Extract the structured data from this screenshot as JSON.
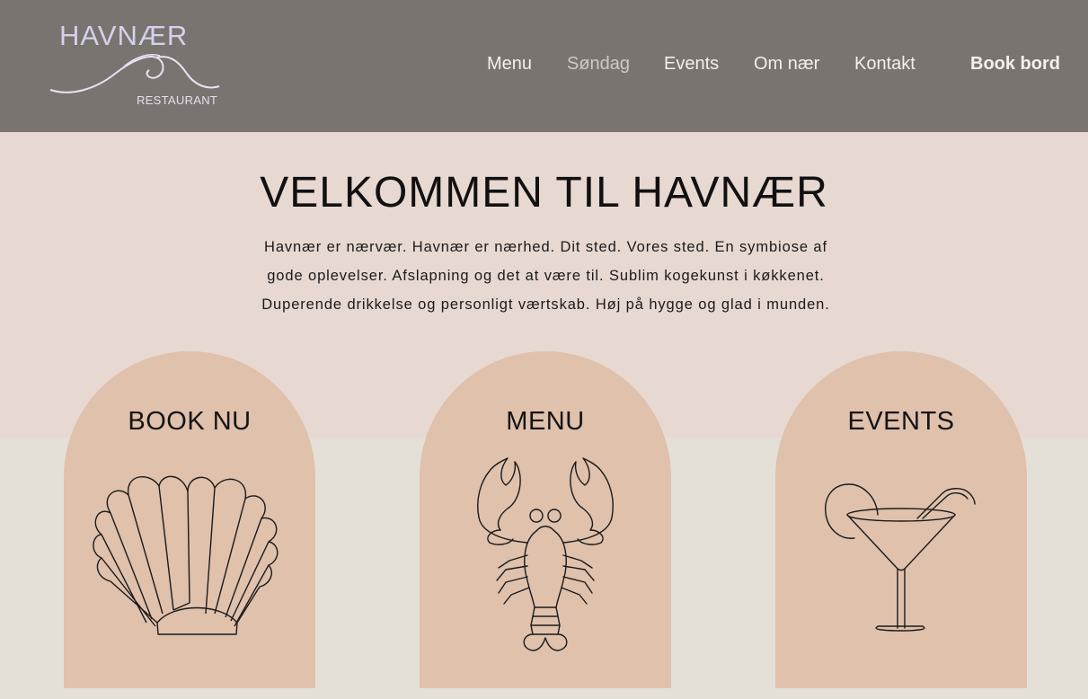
{
  "header": {
    "logo": {
      "name": "HAVNÆR",
      "subtitle": "RESTAURANT"
    },
    "nav": [
      {
        "label": "Menu"
      },
      {
        "label": "Søndag"
      },
      {
        "label": "Events"
      },
      {
        "label": "Om nær"
      },
      {
        "label": "Kontakt"
      }
    ],
    "book_label": "Book bord"
  },
  "hero": {
    "title": "VELKOMMEN TIL HAVNÆR",
    "intro_lines": [
      "Havnær er nærvær. Havnær er nærhed. Dit sted. Vores sted. En symbiose af",
      "gode oplevelser. Afslapning og det at være til. Sublim kogekunst i køkkenet.",
      "Duperende drikkelse og personligt værtskab. Høj på hygge og glad i munden."
    ]
  },
  "cards": [
    {
      "label": "BOOK NU",
      "icon": "shell-icon"
    },
    {
      "label": "MENU",
      "icon": "lobster-icon"
    },
    {
      "label": "EVENTS",
      "icon": "cocktail-icon"
    }
  ],
  "colors": {
    "header_bg": "#7a7471",
    "hero_bg": "#e8d8d2",
    "page_bg": "#e5e0d7",
    "card_bg": "#dfc1ac",
    "logo": "#d6d0ea"
  }
}
